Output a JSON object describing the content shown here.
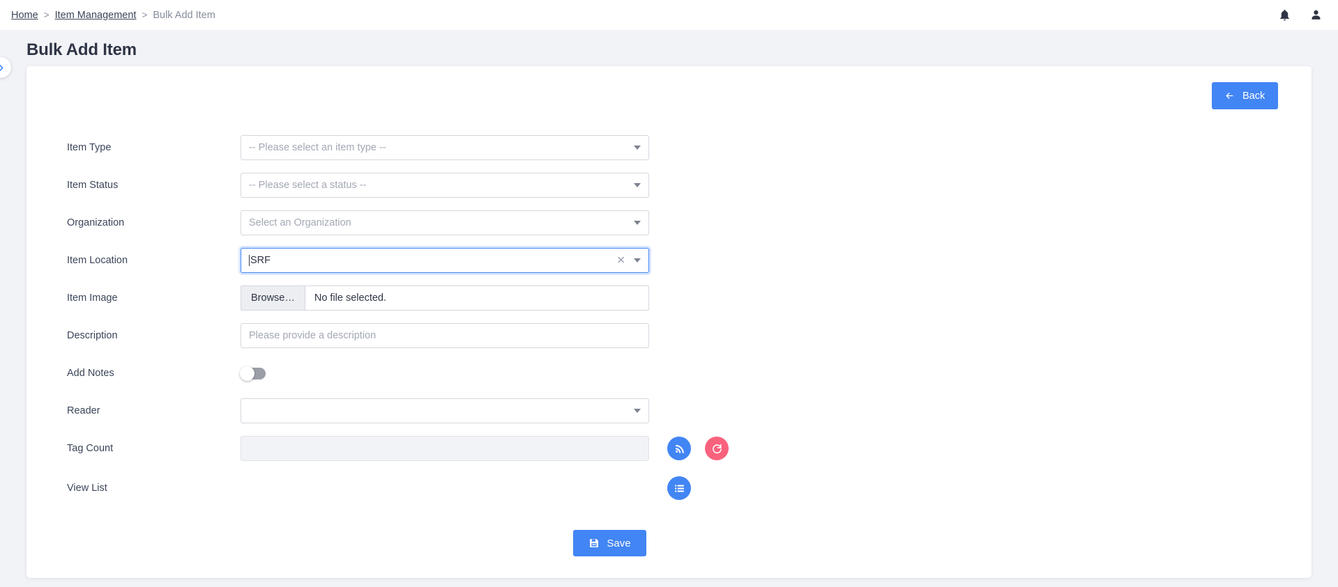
{
  "breadcrumb": {
    "home": "Home",
    "sep1": ">",
    "item_management": "Item Management",
    "sep2": ">",
    "current": "Bulk Add Item"
  },
  "header": {
    "notification_icon": "bell-icon",
    "account_icon": "user-icon"
  },
  "page": {
    "title": "Bulk Add Item"
  },
  "sidebar_toggle": {
    "icon": "chevron-right-icon"
  },
  "card": {
    "back_button": {
      "label": "Back",
      "icon": "arrow-left-icon",
      "color": "#4285f4"
    },
    "fields": {
      "item_type": {
        "label": "Item Type",
        "placeholder": "-- Please select an item type --",
        "value": ""
      },
      "item_status": {
        "label": "Item Status",
        "placeholder": "-- Please select a status --",
        "value": ""
      },
      "organization": {
        "label": "Organization",
        "placeholder": "Select an Organization",
        "value": ""
      },
      "item_location": {
        "label": "Item Location",
        "value": "SRF",
        "clear_icon": "close-icon",
        "focused": true
      },
      "item_image": {
        "label": "Item Image",
        "browse_label": "Browse…",
        "file_status": "No file selected."
      },
      "description": {
        "label": "Description",
        "placeholder": "Please provide a description",
        "value": ""
      },
      "add_notes": {
        "label": "Add Notes",
        "enabled": false
      },
      "reader": {
        "label": "Reader",
        "value": ""
      },
      "tag_count": {
        "label": "Tag Count",
        "value": "",
        "disabled": true
      },
      "view_list": {
        "label": "View List"
      }
    },
    "actions": {
      "scan_button": {
        "icon": "rss-signal-icon",
        "color": "#4285f4"
      },
      "reset_button": {
        "icon": "refresh-icon",
        "color": "#f9627d"
      },
      "list_button": {
        "icon": "list-icon",
        "color": "#4285f4"
      },
      "save_button": {
        "label": "Save",
        "icon": "floppy-disk-icon",
        "color": "#4285f4"
      }
    }
  }
}
